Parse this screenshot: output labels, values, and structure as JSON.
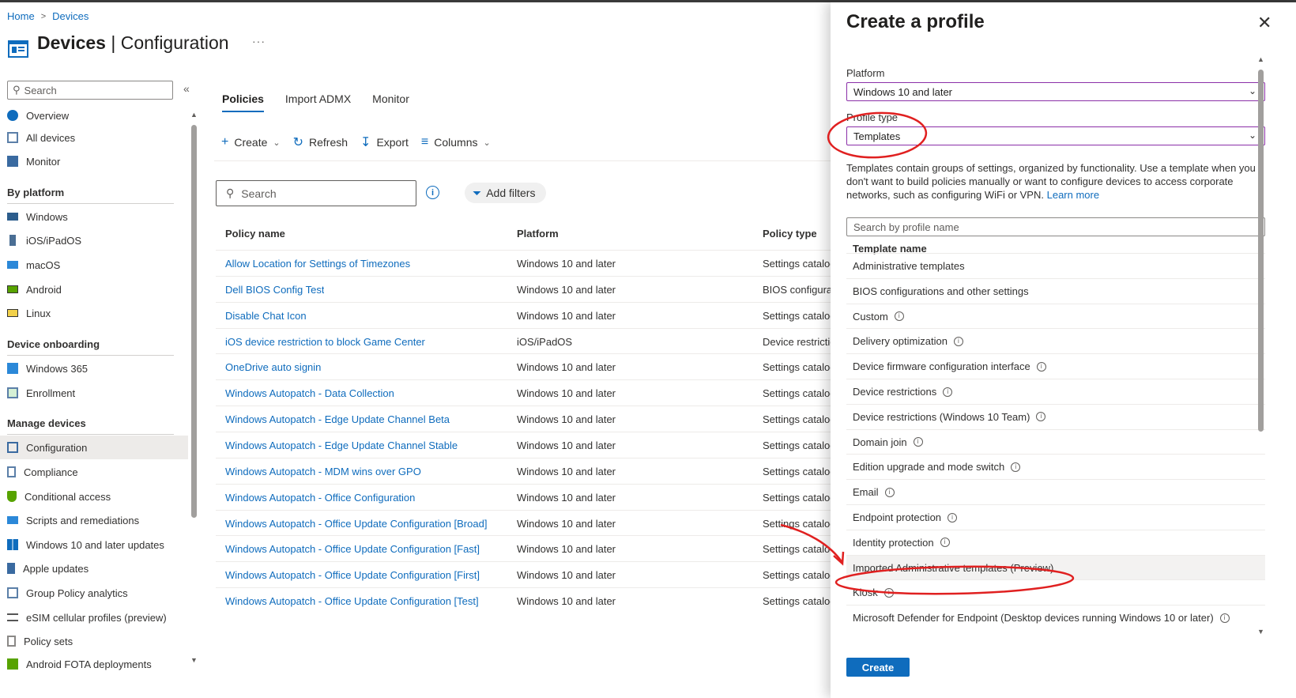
{
  "breadcrumb": {
    "home": "Home",
    "devices": "Devices"
  },
  "page": {
    "title_main": "Devices",
    "title_sep": " | ",
    "title_sub": "Configuration",
    "more": "···"
  },
  "sidebar": {
    "search_placeholder": "Search",
    "collapse": "«",
    "items_top": [
      {
        "label": "Overview",
        "icon": "info-circle-icon"
      },
      {
        "label": "All devices",
        "icon": "devices-icon"
      },
      {
        "label": "Monitor",
        "icon": "monitor-icon"
      }
    ],
    "section_platform": "By platform",
    "items_platform": [
      {
        "label": "Windows",
        "icon": "windows-device-icon"
      },
      {
        "label": "iOS/iPadOS",
        "icon": "phone-icon"
      },
      {
        "label": "macOS",
        "icon": "mac-icon"
      },
      {
        "label": "Android",
        "icon": "android-icon"
      },
      {
        "label": "Linux",
        "icon": "linux-icon"
      }
    ],
    "section_onboarding": "Device onboarding",
    "items_onboarding": [
      {
        "label": "Windows 365",
        "icon": "windows365-icon"
      },
      {
        "label": "Enrollment",
        "icon": "enrollment-icon"
      }
    ],
    "section_manage": "Manage devices",
    "items_manage": [
      {
        "label": "Configuration",
        "icon": "configuration-icon",
        "active": true
      },
      {
        "label": "Compliance",
        "icon": "compliance-icon"
      },
      {
        "label": "Conditional access",
        "icon": "shield-icon"
      },
      {
        "label": "Scripts and remediations",
        "icon": "scripts-icon"
      },
      {
        "label": "Windows 10 and later updates",
        "icon": "windows-logo-icon"
      },
      {
        "label": "Apple updates",
        "icon": "apple-updates-icon"
      },
      {
        "label": "Group Policy analytics",
        "icon": "analytics-icon"
      },
      {
        "label": "eSIM cellular profiles (preview)",
        "icon": "list-icon"
      },
      {
        "label": "Policy sets",
        "icon": "policy-sets-icon"
      },
      {
        "label": "Android FOTA deployments",
        "icon": "android-fota-icon"
      }
    ]
  },
  "tabs": [
    "Policies",
    "Import ADMX",
    "Monitor"
  ],
  "toolbar": {
    "create": "Create",
    "refresh": "Refresh",
    "export": "Export",
    "columns": "Columns"
  },
  "main_search": {
    "placeholder": "Search"
  },
  "add_filters": "Add filters",
  "table": {
    "headers": [
      "Policy name",
      "Platform",
      "Policy type"
    ],
    "rows": [
      [
        "Allow Location for Settings of Timezones",
        "Windows 10 and later",
        "Settings catalog"
      ],
      [
        "Dell BIOS Config Test",
        "Windows 10 and later",
        "BIOS configurations"
      ],
      [
        "Disable Chat Icon",
        "Windows 10 and later",
        "Settings catalog"
      ],
      [
        "iOS device restriction to block Game Center",
        "iOS/iPadOS",
        "Device restrictions"
      ],
      [
        "OneDrive auto signin",
        "Windows 10 and later",
        "Settings catalog"
      ],
      [
        "Windows Autopatch - Data Collection",
        "Windows 10 and later",
        "Settings catalog"
      ],
      [
        "Windows Autopatch - Edge Update Channel Beta",
        "Windows 10 and later",
        "Settings catalog"
      ],
      [
        "Windows Autopatch - Edge Update Channel Stable",
        "Windows 10 and later",
        "Settings catalog"
      ],
      [
        "Windows Autopatch - MDM wins over GPO",
        "Windows 10 and later",
        "Settings catalog"
      ],
      [
        "Windows Autopatch - Office Configuration",
        "Windows 10 and later",
        "Settings catalog"
      ],
      [
        "Windows Autopatch - Office Update Configuration [Broad]",
        "Windows 10 and later",
        "Settings catalog"
      ],
      [
        "Windows Autopatch - Office Update Configuration [Fast]",
        "Windows 10 and later",
        "Settings catalog"
      ],
      [
        "Windows Autopatch - Office Update Configuration [First]",
        "Windows 10 and later",
        "Settings catalog"
      ],
      [
        "Windows Autopatch - Office Update Configuration [Test]",
        "Windows 10 and later",
        "Settings catalog"
      ]
    ]
  },
  "panel": {
    "title": "Create a profile",
    "close": "✕",
    "platform_label": "Platform",
    "platform_value": "Windows 10 and later",
    "profile_type_label": "Profile type",
    "profile_type_value": "Templates",
    "description": "Templates contain groups of settings, organized by functionality. Use a template when you don't want to build policies manually or want to configure devices to access corporate networks, such as configuring WiFi or VPN.",
    "learn_more": "Learn more",
    "search_placeholder": "Search by profile name",
    "list_header": "Template name",
    "templates": [
      {
        "label": "Administrative templates",
        "info": false
      },
      {
        "label": "BIOS configurations and other settings",
        "info": false
      },
      {
        "label": "Custom",
        "info": true
      },
      {
        "label": "Delivery optimization",
        "info": true
      },
      {
        "label": "Device firmware configuration interface",
        "info": true
      },
      {
        "label": "Device restrictions",
        "info": true
      },
      {
        "label": "Device restrictions (Windows 10 Team)",
        "info": true
      },
      {
        "label": "Domain join",
        "info": true
      },
      {
        "label": "Edition upgrade and mode switch",
        "info": true
      },
      {
        "label": "Email",
        "info": true
      },
      {
        "label": "Endpoint protection",
        "info": true
      },
      {
        "label": "Identity protection",
        "info": true
      },
      {
        "label": "Imported Administrative templates (Preview)",
        "info": false,
        "highlighted": true
      },
      {
        "label": "Kiosk",
        "info": true
      },
      {
        "label": "Microsoft Defender for Endpoint (Desktop devices running Windows 10 or later)",
        "info": true
      }
    ],
    "create_button": "Create"
  },
  "colors": {
    "accent": "#0f6cbd",
    "annotation": "#e02020",
    "select_border": "#8b2fa8"
  }
}
